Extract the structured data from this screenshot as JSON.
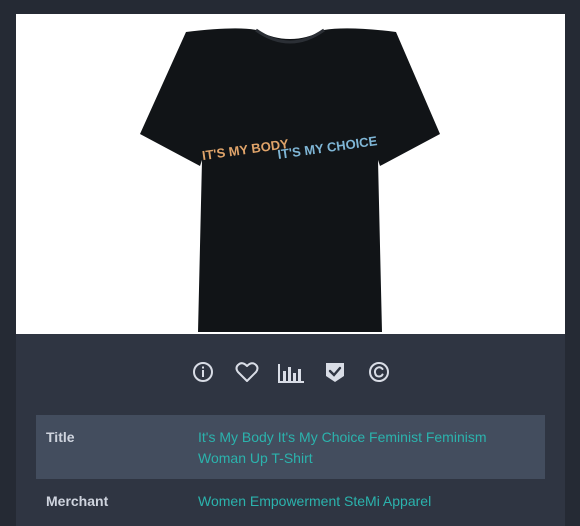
{
  "product": {
    "print_text_left": "IT'S MY BODY",
    "print_text_right": "IT'S MY CHOICE",
    "shirt_color": "#111417"
  },
  "icons": [
    "info-icon",
    "heart-icon",
    "bar-chart-icon",
    "verified-badge-icon",
    "copyright-icon"
  ],
  "details": [
    {
      "key": "Title",
      "value": "It's My Body It's My Choice Feminist Feminism Woman Up T-Shirt"
    },
    {
      "key": "Merchant",
      "value": "Women Empowerment SteMi Apparel"
    }
  ],
  "colors": {
    "page_bg": "#252a34",
    "card_bg": "#2f3542",
    "row_alt_bg": "#434d5e",
    "link": "#2bb3ad",
    "icon": "#d9dde6"
  }
}
